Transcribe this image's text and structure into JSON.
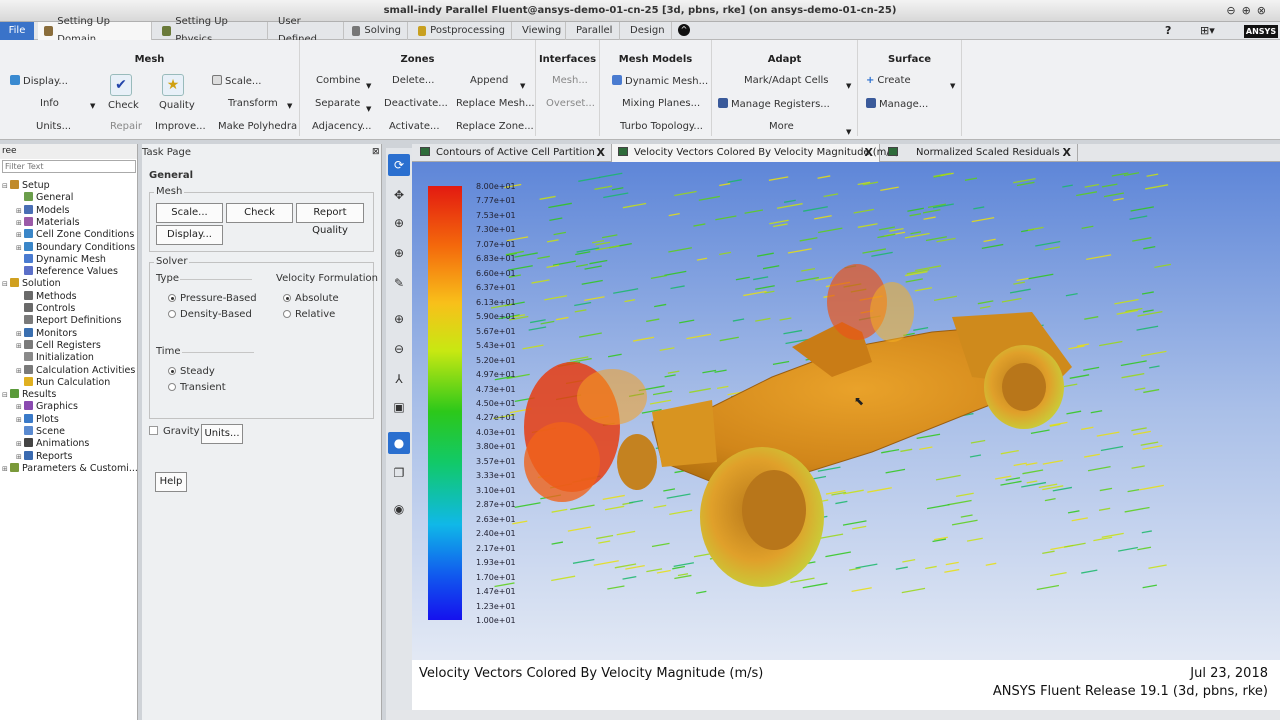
{
  "window": {
    "title": "small-indy Parallel Fluent@ansys-demo-01-cn-25  [3d, pbns, rke]  (on ansys-demo-01-cn-25)"
  },
  "ribbon_tabs": [
    "File",
    "Setting Up Domain",
    "Setting Up Physics",
    "User Defined",
    "Solving",
    "Postprocessing",
    "Viewing",
    "Parallel",
    "Design"
  ],
  "ribbon": {
    "mesh": {
      "title": "Mesh",
      "display": "Display...",
      "info": "Info",
      "units": "Units...",
      "check": "Check",
      "repair": "Repair",
      "quality": "Quality",
      "improve": "Improve...",
      "scale": "Scale...",
      "transform": "Transform",
      "make_polyhedra": "Make Polyhedra"
    },
    "zones": {
      "title": "Zones",
      "combine": "Combine",
      "separate": "Separate",
      "adjacency": "Adjacency...",
      "delete": "Delete...",
      "deactivate": "Deactivate...",
      "activate": "Activate...",
      "append": "Append",
      "replace_mesh": "Replace Mesh...",
      "replace_zone": "Replace Zone..."
    },
    "interfaces": {
      "title": "Interfaces",
      "mesh": "Mesh...",
      "overset": "Overset..."
    },
    "mesh_models": {
      "title": "Mesh Models",
      "dynamic_mesh": "Dynamic Mesh...",
      "mixing_planes": "Mixing Planes...",
      "turbo_topology": "Turbo Topology..."
    },
    "adapt": {
      "title": "Adapt",
      "mark_adapt": "Mark/Adapt Cells",
      "manage_registers": "Manage Registers...",
      "more": "More"
    },
    "surface": {
      "title": "Surface",
      "create": "Create",
      "manage": "Manage..."
    }
  },
  "tree": {
    "header": "ree",
    "filter_placeholder": "Filter Text",
    "items": [
      {
        "label": "Setup",
        "level": 0,
        "exp": "⊟",
        "color": "#c08a2a"
      },
      {
        "label": "General",
        "level": 1,
        "exp": "",
        "color": "#6b9e4b"
      },
      {
        "label": "Models",
        "level": 1,
        "exp": "⊞",
        "color": "#4a6fb5"
      },
      {
        "label": "Materials",
        "level": 1,
        "exp": "⊞",
        "color": "#9b5aa8"
      },
      {
        "label": "Cell Zone Conditions",
        "level": 1,
        "exp": "⊞",
        "color": "#3a86c8"
      },
      {
        "label": "Boundary Conditions",
        "level": 1,
        "exp": "⊞",
        "color": "#3a86c8"
      },
      {
        "label": "Dynamic Mesh",
        "level": 1,
        "exp": "",
        "color": "#4a7bd0"
      },
      {
        "label": "Reference Values",
        "level": 1,
        "exp": "",
        "color": "#5b6fc8"
      },
      {
        "label": "Solution",
        "level": 0,
        "exp": "⊟",
        "color": "#d0a020"
      },
      {
        "label": "Methods",
        "level": 1,
        "exp": "",
        "color": "#6a6a6a"
      },
      {
        "label": "Controls",
        "level": 1,
        "exp": "",
        "color": "#6a6a6a"
      },
      {
        "label": "Report Definitions",
        "level": 1,
        "exp": "",
        "color": "#7a7a7a"
      },
      {
        "label": "Monitors",
        "level": 1,
        "exp": "⊞",
        "color": "#3a6fb0"
      },
      {
        "label": "Cell Registers",
        "level": 1,
        "exp": "⊞",
        "color": "#7a7a7a"
      },
      {
        "label": "Initialization",
        "level": 1,
        "exp": "",
        "color": "#8a8a8a"
      },
      {
        "label": "Calculation Activities",
        "level": 1,
        "exp": "⊞",
        "color": "#7a7a7a"
      },
      {
        "label": "Run Calculation",
        "level": 1,
        "exp": "",
        "color": "#e0b020"
      },
      {
        "label": "Results",
        "level": 0,
        "exp": "⊟",
        "color": "#5a9a3a"
      },
      {
        "label": "Graphics",
        "level": 1,
        "exp": "⊞",
        "color": "#8a4ab0"
      },
      {
        "label": "Plots",
        "level": 1,
        "exp": "⊞",
        "color": "#3a7ac8"
      },
      {
        "label": "Scene",
        "level": 1,
        "exp": "",
        "color": "#5a8ad0"
      },
      {
        "label": "Animations",
        "level": 1,
        "exp": "⊞",
        "color": "#444"
      },
      {
        "label": "Reports",
        "level": 1,
        "exp": "⊞",
        "color": "#3a6ab0"
      },
      {
        "label": "Parameters & Customi...",
        "level": 0,
        "exp": "⊞",
        "color": "#7a9a3a"
      }
    ]
  },
  "task": {
    "header": "Task Page",
    "section": "General",
    "mesh_label": "Mesh",
    "scale_btn": "Scale...",
    "check_btn": "Check",
    "report_quality_btn": "Report Quality",
    "display_btn": "Display...",
    "solver_label": "Solver",
    "type_label": "Type",
    "pressure_based": "Pressure-Based",
    "density_based": "Density-Based",
    "velocity_formulation": "Velocity Formulation",
    "absolute": "Absolute",
    "relative": "Relative",
    "time_label": "Time",
    "steady": "Steady",
    "transient": "Transient",
    "gravity": "Gravity",
    "units_btn": "Units...",
    "help_btn": "Help"
  },
  "graphics_tabs": [
    "Contours of Active Cell Partition",
    "Velocity Vectors Colored By Velocity Magnitude (m/s)",
    "Normalized Scaled Residuals"
  ],
  "colorbar_ticks": [
    "8.00e+01",
    "7.77e+01",
    "7.53e+01",
    "7.30e+01",
    "7.07e+01",
    "6.83e+01",
    "6.60e+01",
    "6.37e+01",
    "6.13e+01",
    "5.90e+01",
    "5.67e+01",
    "5.43e+01",
    "5.20e+01",
    "4.97e+01",
    "4.73e+01",
    "4.50e+01",
    "4.27e+01",
    "4.03e+01",
    "3.80e+01",
    "3.57e+01",
    "3.33e+01",
    "3.10e+01",
    "2.87e+01",
    "2.63e+01",
    "2.40e+01",
    "2.17e+01",
    "1.93e+01",
    "1.70e+01",
    "1.47e+01",
    "1.23e+01",
    "1.00e+01"
  ],
  "footer": {
    "caption": "Velocity Vectors Colored By Velocity Magnitude (m/s)",
    "date": "Jul 23, 2018",
    "release": "ANSYS Fluent Release 19.1 (3d, pbns, rke)"
  },
  "brand": "ANSYS",
  "colors": {
    "accent": "#2a6fcf",
    "file_tab": "#3a73c9",
    "body": "#d88a1c"
  }
}
